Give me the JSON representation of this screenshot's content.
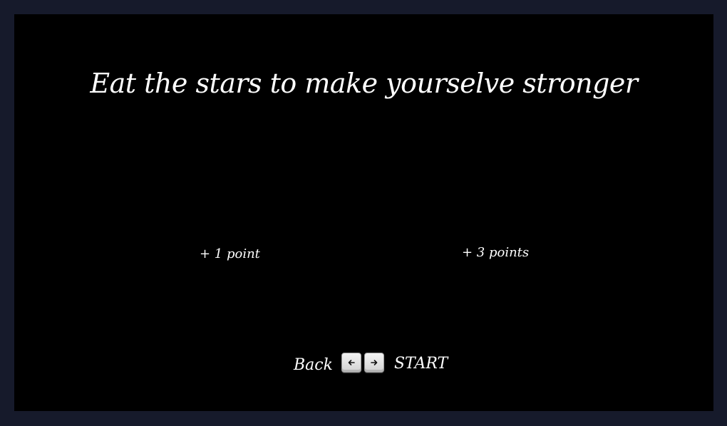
{
  "title": "Eat the stars to make yourselve stronger",
  "rewards": [
    {
      "label": "+ 1 point"
    },
    {
      "label": "+ 3 points"
    }
  ],
  "controls": {
    "back_label": "Back",
    "start_label": "START",
    "left_key_icon": "arrow-left-icon",
    "right_key_icon": "arrow-right-icon"
  },
  "colors": {
    "frame": "#161a2b",
    "stage": "#000000",
    "text": "#ffffff",
    "key_face": "#e6e6e6"
  }
}
